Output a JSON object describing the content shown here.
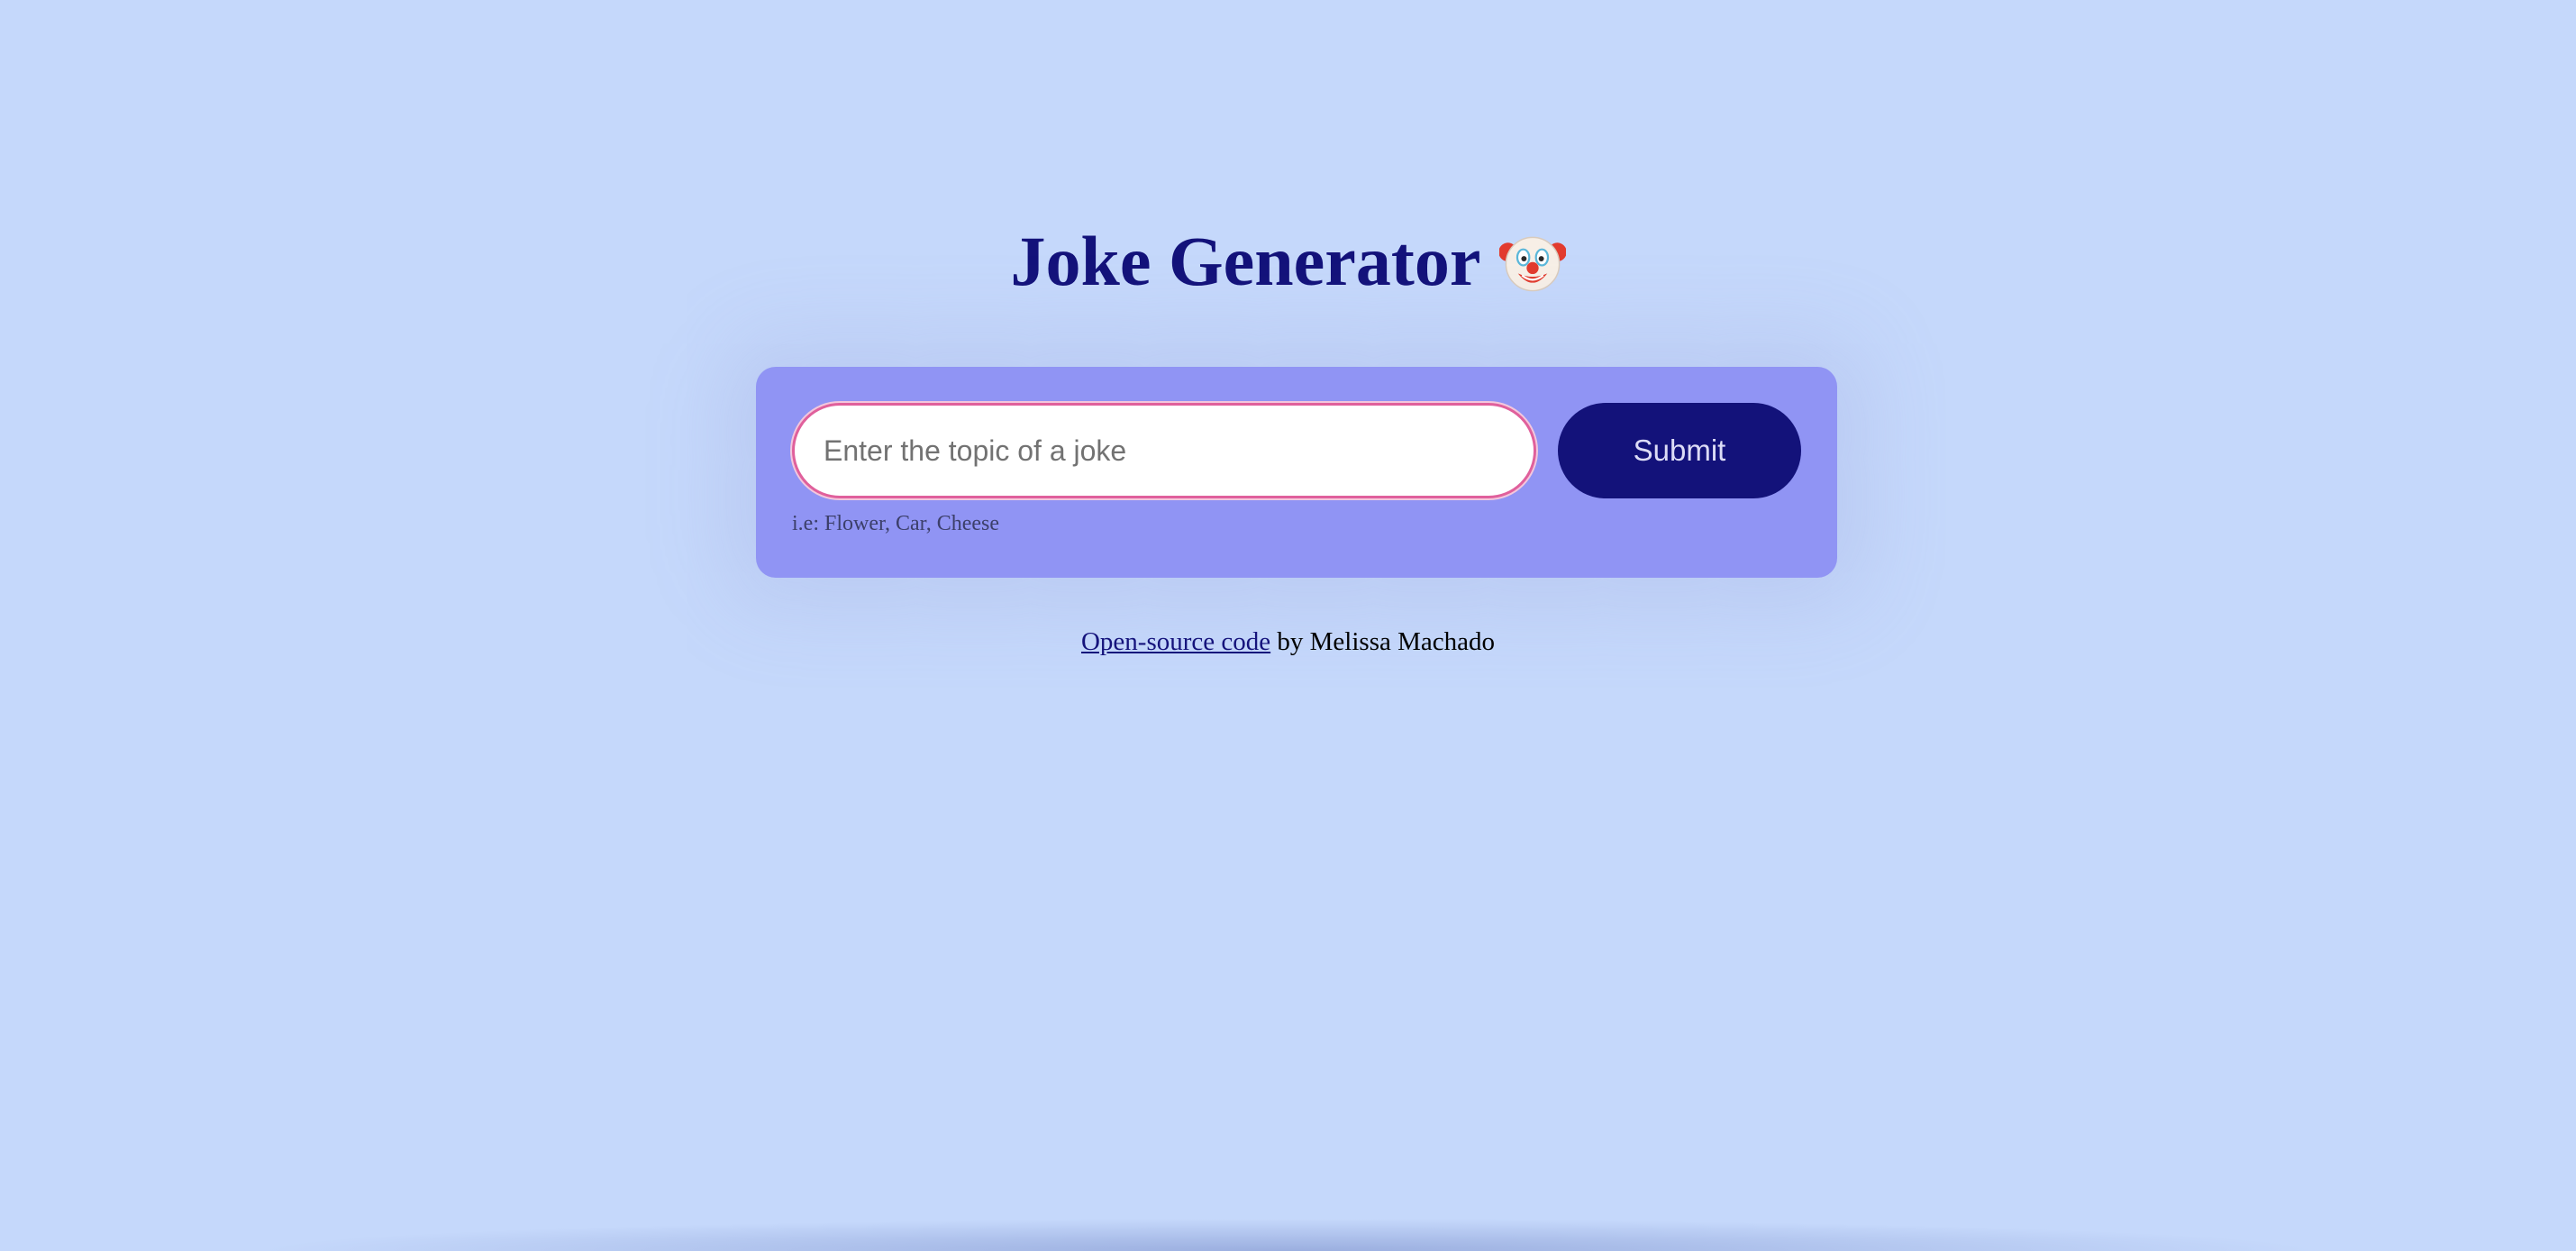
{
  "header": {
    "title": "Joke Generator",
    "title_icon": "clown-face-icon"
  },
  "form": {
    "topic_placeholder": "Enter the topic of a joke",
    "topic_value": "",
    "submit_label": "Submit",
    "hint": "i.e: Flower, Car, Cheese"
  },
  "footer": {
    "link_text": "Open-source code",
    "byline": " by Melissa Machado"
  },
  "colors": {
    "background": "#c5d8fb",
    "card": "#9094f4",
    "accent": "#13127a",
    "input_border": "#e0609c"
  }
}
